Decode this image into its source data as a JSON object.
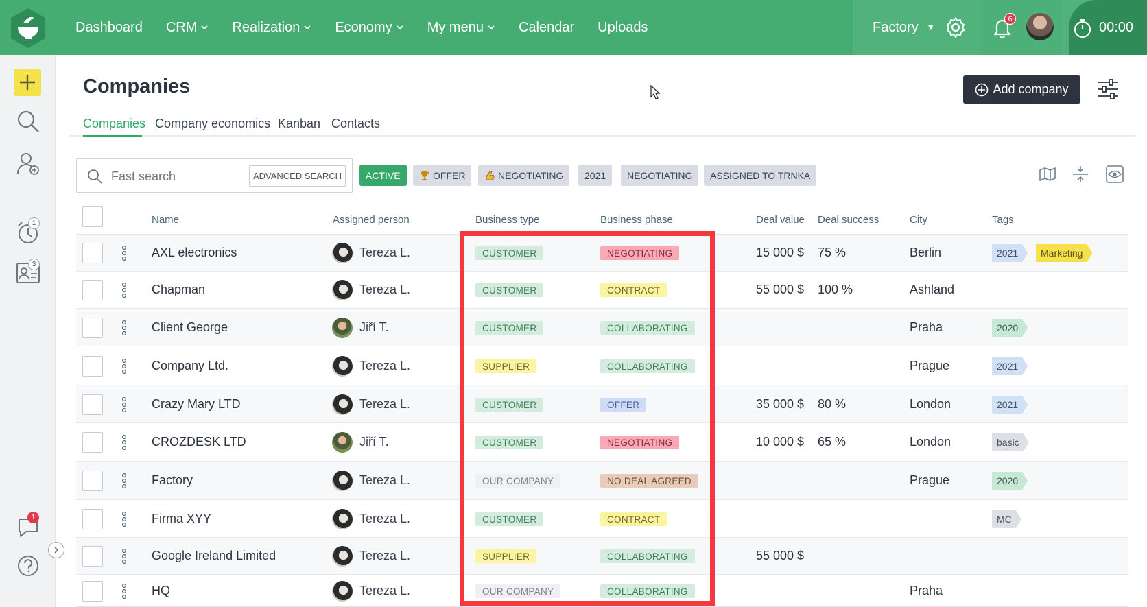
{
  "nav": {
    "items": [
      {
        "label": "Dashboard",
        "dropdown": false
      },
      {
        "label": "CRM",
        "dropdown": true
      },
      {
        "label": "Realization",
        "dropdown": true
      },
      {
        "label": "Economy",
        "dropdown": true
      },
      {
        "label": "My menu",
        "dropdown": true
      },
      {
        "label": "Calendar",
        "dropdown": false
      },
      {
        "label": "Uploads",
        "dropdown": false
      }
    ],
    "workspace": "Factory",
    "notifications_count": "6",
    "timer": "00:00"
  },
  "sidebar": {
    "reminders_count": "1",
    "contacts_count": "3",
    "chat_count": "1"
  },
  "header": {
    "title": "Companies",
    "add_button": "Add company"
  },
  "tabs": [
    "Companies",
    "Company economics",
    "Kanban",
    "Contacts"
  ],
  "search": {
    "placeholder": "Fast search",
    "advanced_label": "ADVANCED SEARCH"
  },
  "filters": [
    {
      "label": "ACTIVE",
      "style": "green",
      "icon": ""
    },
    {
      "label": "OFFER",
      "style": "grey",
      "icon": "trophy-icon"
    },
    {
      "label": "NEGOTIATING",
      "style": "grey",
      "icon": "flexed-arm-icon"
    },
    {
      "label": "2021",
      "style": "grey",
      "icon": ""
    },
    {
      "label": "NEGOTIATING",
      "style": "grey",
      "icon": ""
    },
    {
      "label": "ASSIGNED TO TRNKA",
      "style": "grey",
      "icon": ""
    }
  ],
  "table": {
    "columns": [
      "Name",
      "Assigned person",
      "Business type",
      "Business phase",
      "Deal value",
      "Deal success",
      "City",
      "Tags"
    ],
    "rows": [
      {
        "name": "AXL electronics",
        "person": "Tereza L.",
        "avatar": "t",
        "type": "CUSTOMER",
        "phase": "NEGOTIATING",
        "deal_value": "15 000 $",
        "deal_success": "75 %",
        "city": "Berlin",
        "tags": [
          {
            "label": "2021",
            "color": "#cfe0f7"
          },
          {
            "label": "Marketing",
            "color": "#f5e24a"
          }
        ]
      },
      {
        "name": "Chapman",
        "person": "Tereza L.",
        "avatar": "t",
        "type": "CUSTOMER",
        "phase": "CONTRACT",
        "deal_value": "55 000 $",
        "deal_success": "100 %",
        "city": "Ashland",
        "tags": []
      },
      {
        "name": "Client George",
        "person": "Jiří T.",
        "avatar": "j",
        "type": "CUSTOMER",
        "phase": "COLLABORATING",
        "deal_value": "",
        "deal_success": "",
        "city": "Praha",
        "tags": [
          {
            "label": "2020",
            "color": "#c6e9d4"
          }
        ]
      },
      {
        "name": "Company Ltd.",
        "person": "Tereza L.",
        "avatar": "t",
        "type": "SUPPLIER",
        "phase": "COLLABORATING",
        "deal_value": "",
        "deal_success": "",
        "city": "Prague",
        "tags": [
          {
            "label": "2021",
            "color": "#cfe0f7"
          }
        ]
      },
      {
        "name": "Crazy Mary LTD",
        "person": "Tereza L.",
        "avatar": "t",
        "type": "CUSTOMER",
        "phase": "OFFER",
        "deal_value": "35 000 $",
        "deal_success": "80 %",
        "city": "London",
        "tags": [
          {
            "label": "2021",
            "color": "#cfe0f7"
          }
        ]
      },
      {
        "name": "CROZDESK LTD",
        "person": "Jiří T.",
        "avatar": "j",
        "type": "CUSTOMER",
        "phase": "NEGOTIATING",
        "deal_value": "10 000 $",
        "deal_success": "65 %",
        "city": "London",
        "tags": [
          {
            "label": "basic",
            "color": "#dcdfe4"
          }
        ]
      },
      {
        "name": "Factory",
        "person": "Tereza L.",
        "avatar": "t",
        "type": "OUR COMPANY",
        "phase": "NO DEAL AGREED",
        "deal_value": "",
        "deal_success": "",
        "city": "Prague",
        "tags": [
          {
            "label": "2020",
            "color": "#c6e9d4"
          }
        ]
      },
      {
        "name": "Firma XYY",
        "person": "Tereza L.",
        "avatar": "t",
        "type": "CUSTOMER",
        "phase": "CONTRACT",
        "deal_value": "",
        "deal_success": "",
        "city": "",
        "tags": [
          {
            "label": "MC",
            "color": "#dcdfe4"
          }
        ]
      },
      {
        "name": "Google Ireland Limited",
        "person": "Tereza L.",
        "avatar": "t",
        "type": "SUPPLIER",
        "phase": "COLLABORATING",
        "deal_value": "55 000 $",
        "deal_success": "",
        "city": "",
        "tags": []
      },
      {
        "name": "HQ",
        "person": "Tereza L.",
        "avatar": "t",
        "type": "OUR COMPANY",
        "phase": "COLLABORATING",
        "deal_value": "",
        "deal_success": "",
        "city": "Praha",
        "tags": []
      }
    ]
  },
  "pill_colors": {
    "CUSTOMER": {
      "bg": "#d3ecdd",
      "fg": "#3f7f5a"
    },
    "SUPPLIER": {
      "bg": "#fbf4a0",
      "fg": "#6f6a2c"
    },
    "OUR COMPANY": {
      "bg": "#eef0f3",
      "fg": "#7b828c"
    },
    "NEGOTIATING": {
      "bg": "#f7a9b6",
      "fg": "#8e2b3c"
    },
    "CONTRACT": {
      "bg": "#fbf4a0",
      "fg": "#6f6a2c"
    },
    "COLLABORATING": {
      "bg": "#d3ecdd",
      "fg": "#3f7f5a"
    },
    "OFFER": {
      "bg": "#cfdcf5",
      "fg": "#4a5f9a"
    },
    "NO DEAL AGREED": {
      "bg": "#e8cbb8",
      "fg": "#6f4b36"
    }
  },
  "colors": {
    "topbar": "#45ac72",
    "accent": "#2ea866",
    "dark_button": "#2d3440",
    "highlight_box": "#f3393f"
  }
}
